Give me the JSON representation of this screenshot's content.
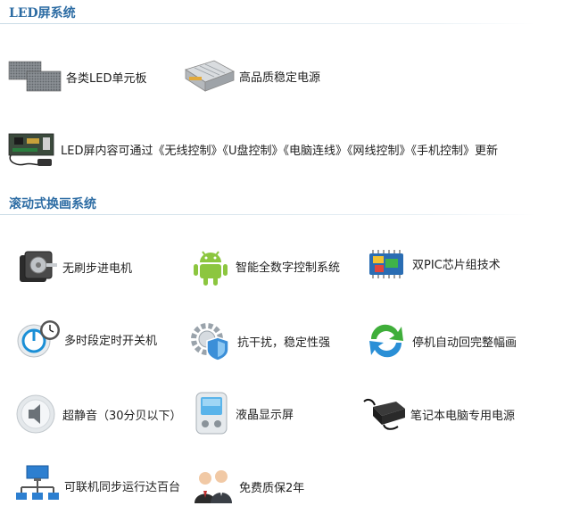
{
  "sections": [
    {
      "title": "LED屏系统",
      "items": [
        {
          "label": "各类LED单元板",
          "icon": "led-panel-icon"
        },
        {
          "label": "高品质稳定电源",
          "icon": "power-supply-icon"
        },
        {
          "label": "LED屏内容可通过《无线控制》《U盘控制》《电脑连线》《网线控制》《手机控制》更新",
          "icon": "control-card-icon"
        }
      ]
    },
    {
      "title": "滚动式换画系统",
      "items": [
        {
          "label": "无刷步进电机",
          "icon": "stepper-motor-icon"
        },
        {
          "label": "智能全数字控制系统",
          "icon": "android-icon"
        },
        {
          "label": "双PIC芯片组技术",
          "icon": "chip-icon"
        },
        {
          "label": "多时段定时开关机",
          "icon": "power-clock-icon"
        },
        {
          "label": "抗干扰，稳定性强",
          "icon": "shield-gear-icon"
        },
        {
          "label": "停机自动回完整幅画",
          "icon": "refresh-icon"
        },
        {
          "label": "超静音（30分贝以下）",
          "icon": "speaker-icon"
        },
        {
          "label": "液晶显示屏",
          "icon": "lcd-device-icon"
        },
        {
          "label": "笔记本电脑专用电源",
          "icon": "laptop-adapter-icon"
        },
        {
          "label": "可联机同步运行达百台",
          "icon": "network-icon"
        },
        {
          "label": "免费质保2年",
          "icon": "support-people-icon"
        }
      ]
    }
  ]
}
